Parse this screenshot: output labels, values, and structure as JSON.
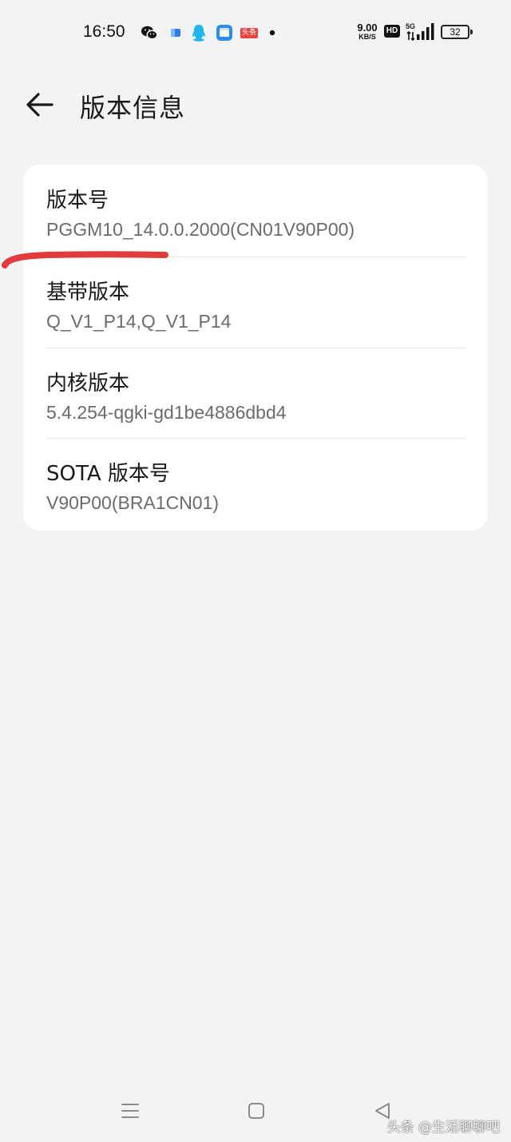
{
  "status_bar": {
    "time": "16:50",
    "net_speed_value": "9.00",
    "net_speed_unit": "KB/S",
    "hd_label": "HD",
    "network_type": "5G",
    "battery_level": "32",
    "notification_icons": [
      "wechat-icon",
      "app-icon",
      "qq-icon",
      "calendar-app-icon",
      "toutiao-icon",
      "more-dot-icon"
    ],
    "toutiao_badge": "头条"
  },
  "header": {
    "title": "版本信息",
    "back_icon": "arrow-left-icon"
  },
  "version_info": {
    "items": [
      {
        "label": "版本号",
        "value": "PGGM10_14.0.0.2000(CN01V90P00)"
      },
      {
        "label": "基带版本",
        "value": "Q_V1_P14,Q_V1_P14"
      },
      {
        "label": "内核版本",
        "value": "5.4.254-qgki-gd1be4886dbd4"
      },
      {
        "label": "SOTA 版本号",
        "value": "V90P00(BRA1CN01)"
      }
    ]
  },
  "nav_bar": {
    "icons": [
      "menu-icon",
      "home-icon",
      "back-triangle-icon"
    ]
  },
  "watermark": "头条 @生活聊聊吧",
  "colors": {
    "background": "#f2f3f5",
    "card": "#ffffff",
    "annotation": "#e03c3c",
    "secondary_text": "#6b6b6b"
  }
}
